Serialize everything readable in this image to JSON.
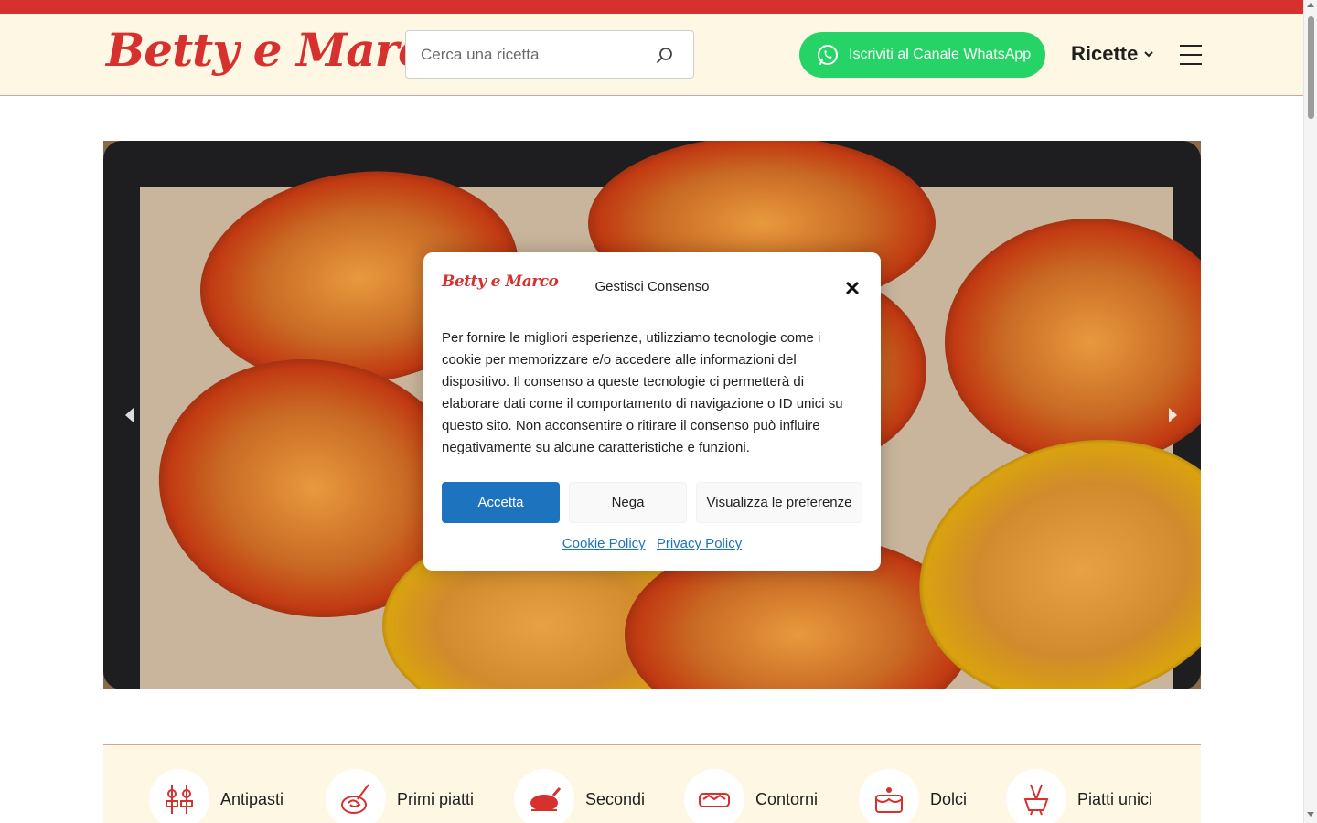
{
  "header": {
    "logo_text": "Betty e Marco",
    "search_placeholder": "Cerca una ricetta",
    "whatsapp_label": "Iscriviti al Canale WhatsApp",
    "recipes_label": "Ricette"
  },
  "colors": {
    "brand_red": "#d6312e",
    "header_bg": "#fef7e4",
    "whatsapp_green": "#25d366",
    "accept_blue": "#1e73be"
  },
  "hero": {
    "image_icon": "stuffed-peppers-photo"
  },
  "categories": [
    {
      "label": "Antipasti",
      "icon": "skewers-icon"
    },
    {
      "label": "Primi piatti",
      "icon": "pasta-icon"
    },
    {
      "label": "Secondi",
      "icon": "roast-chicken-icon"
    },
    {
      "label": "Contorni",
      "icon": "vegetables-dish-icon"
    },
    {
      "label": "Dolci",
      "icon": "cake-icon"
    },
    {
      "label": "Piatti unici",
      "icon": "fondue-icon"
    }
  ],
  "consent": {
    "logo_text": "Betty e Marco",
    "title": "Gestisci Consenso",
    "body": "Per fornire le migliori esperienze, utilizziamo tecnologie come i cookie per memorizzare e/o accedere alle informazioni del dispositivo. Il consenso a queste tecnologie ci permetterà di elaborare dati come il comportamento di navigazione o ID unici su questo sito. Non acconsentire o ritirare il consenso può influire negativamente su alcune caratteristiche e funzioni.",
    "accept_label": "Accetta",
    "deny_label": "Nega",
    "prefs_label": "Visualizza le preferenze",
    "cookie_policy_label": "Cookie Policy",
    "privacy_policy_label": "Privacy Policy"
  }
}
